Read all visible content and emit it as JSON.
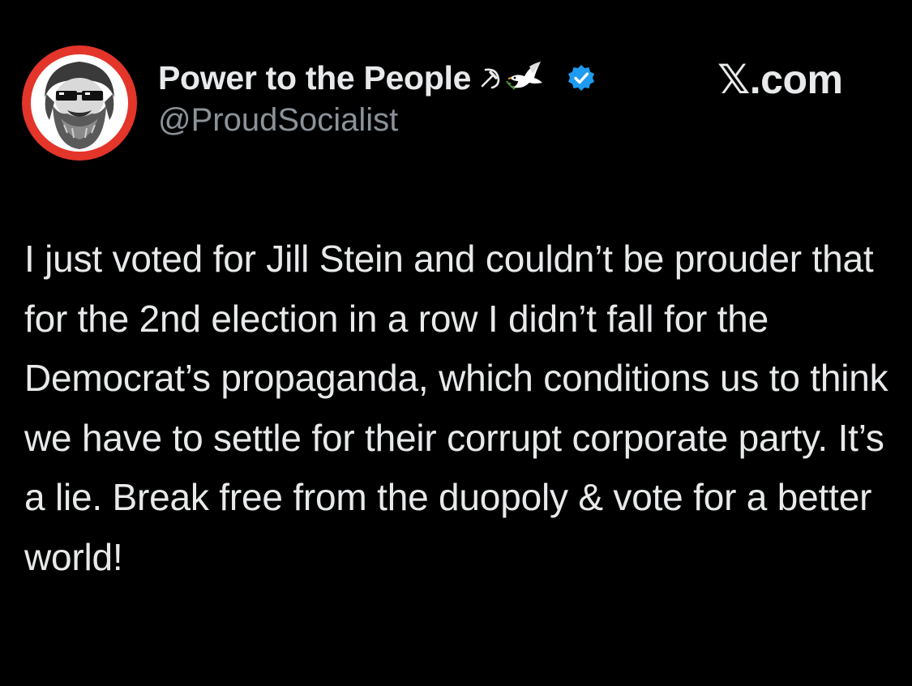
{
  "account": {
    "display_name": "Power to the People",
    "name_emojis": [
      "hammer-and-sickle-icon",
      "dove-icon"
    ],
    "verified": true,
    "handle": "@ProudSocialist",
    "avatar_icon": "bearded-man-with-sunglasses-avatar"
  },
  "brand": {
    "label": "𝕏.com"
  },
  "tweet": {
    "text": "I just voted for Jill Stein and couldn’t be prouder that for the 2nd election in a row I didn’t fall for the Democrat’s propaganda, which conditions us to think we have to settle for their corrupt corporate party. It’s a lie. Break free from the duopoly & vote for a better world!"
  },
  "colors": {
    "background": "#000000",
    "text_primary": "#e7e9ea",
    "text_secondary": "#8b9298",
    "verified_blue": "#1d9bf0",
    "avatar_red": "#e3352a"
  }
}
